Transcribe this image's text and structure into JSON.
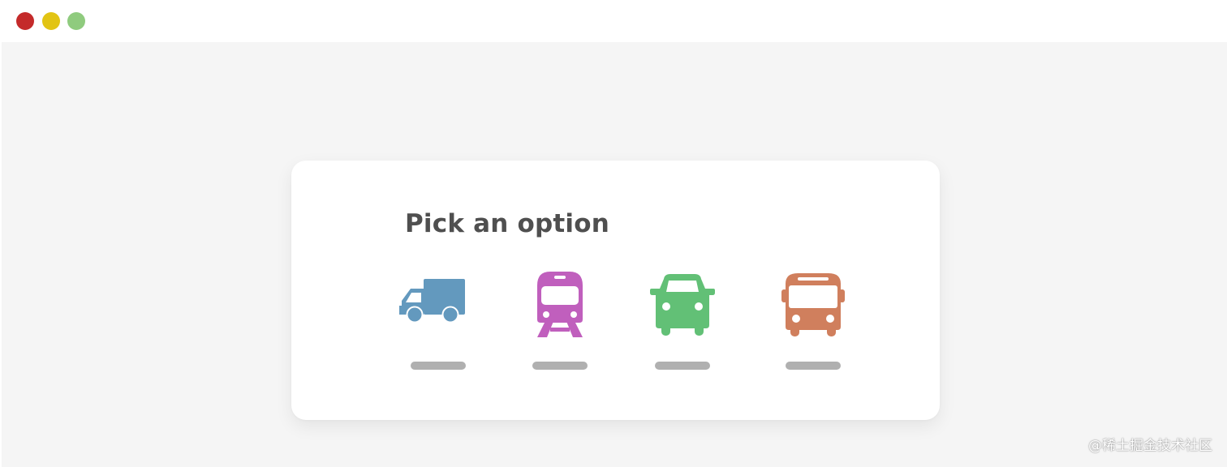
{
  "window": {
    "controls": [
      {
        "name": "close",
        "color": "#c42a2a"
      },
      {
        "name": "minimize",
        "color": "#e2c414"
      },
      {
        "name": "maximize",
        "color": "#8fcb7e"
      }
    ]
  },
  "colors": {
    "page_background": "#f5f5f5",
    "card_background": "#ffffff",
    "title_text": "#4f4f4f",
    "label_placeholder": "#b0b0b0"
  },
  "card": {
    "title": "Pick an option",
    "options": [
      {
        "icon": "truck-icon",
        "color": "#6399be",
        "label": ""
      },
      {
        "icon": "train-icon",
        "color": "#c05fbd",
        "label": ""
      },
      {
        "icon": "car-icon",
        "color": "#62c076",
        "label": ""
      },
      {
        "icon": "bus-icon",
        "color": "#d07f5d",
        "label": ""
      }
    ]
  },
  "watermark": "@稀土掘金技术社区"
}
